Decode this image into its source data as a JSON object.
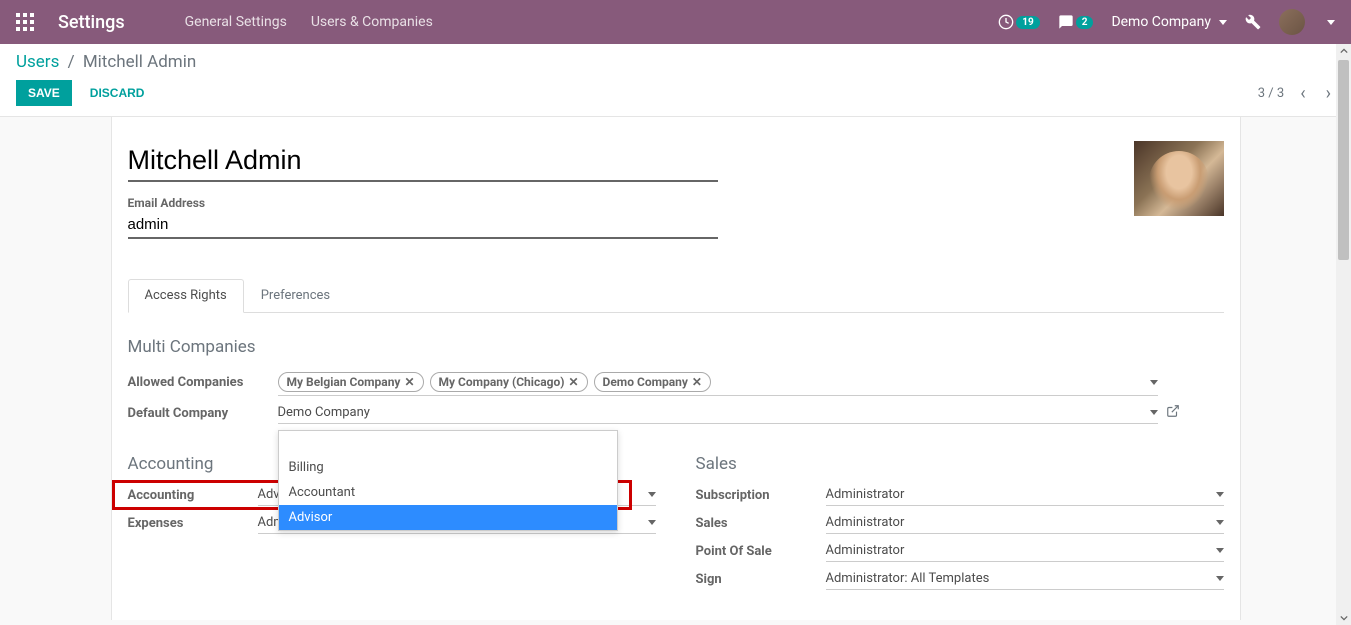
{
  "topbar": {
    "title": "Settings",
    "menu": [
      "General Settings",
      "Users & Companies"
    ],
    "clock_badge": "19",
    "chat_badge": "2",
    "company": "Demo Company"
  },
  "breadcrumb": {
    "parent": "Users",
    "current": "Mitchell Admin"
  },
  "actions": {
    "save": "SAVE",
    "discard": "DISCARD"
  },
  "pager": "3 / 3",
  "form": {
    "name": "Mitchell Admin",
    "email_label": "Email Address",
    "email": "admin"
  },
  "tabs": [
    "Access Rights",
    "Preferences"
  ],
  "multi_companies": {
    "title": "Multi Companies",
    "allowed_label": "Allowed Companies",
    "allowed_tags": [
      "My Belgian Company",
      "My Company (Chicago)",
      "Demo Company"
    ],
    "default_label": "Default Company",
    "default_value": "Demo Company"
  },
  "dropdown_options": [
    "",
    "Billing",
    "Accountant",
    "Advisor"
  ],
  "dropdown_selected_index": 3,
  "accounting": {
    "title": "Accounting",
    "rows": [
      {
        "label": "Accounting",
        "value": "Advisor"
      },
      {
        "label": "Expenses",
        "value": "Administrator"
      }
    ]
  },
  "sales": {
    "title": "Sales",
    "rows": [
      {
        "label": "Subscription",
        "value": "Administrator"
      },
      {
        "label": "Sales",
        "value": "Administrator"
      },
      {
        "label": "Point Of Sale",
        "value": "Administrator"
      },
      {
        "label": "Sign",
        "value": "Administrator: All Templates"
      }
    ]
  }
}
